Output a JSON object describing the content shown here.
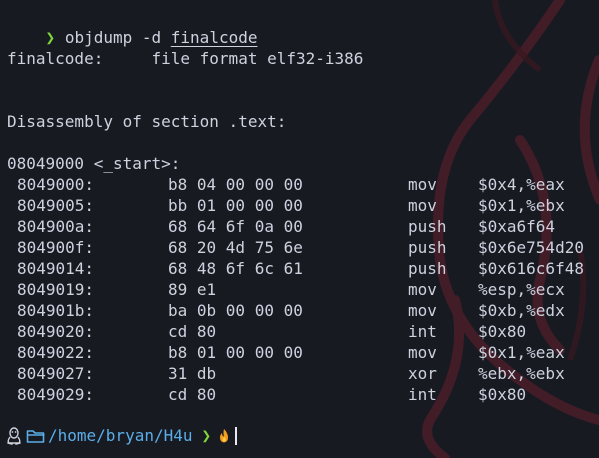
{
  "colors": {
    "background": "#181a22",
    "text": "#cdd2de",
    "prompt_arrow": "#7fd63b",
    "path": "#5aaee8",
    "flame": "#f39c1e",
    "decor": "#4a1d27"
  },
  "top_prompt": {
    "arrow": "❯",
    "command": "objdump -d",
    "argument": "finalcode"
  },
  "output": {
    "file_format_line": "finalcode:     file format elf32-i386",
    "section_line": "Disassembly of section .text:",
    "symbol_line": "08049000 <_start>:"
  },
  "disassembly": [
    {
      "addr": "8049000:",
      "bytes": "b8 04 00 00 00",
      "mnemonic": "mov",
      "operands": "$0x4,%eax"
    },
    {
      "addr": "8049005:",
      "bytes": "bb 01 00 00 00",
      "mnemonic": "mov",
      "operands": "$0x1,%ebx"
    },
    {
      "addr": "804900a:",
      "bytes": "68 64 6f 0a 00",
      "mnemonic": "push",
      "operands": "$0xa6f64"
    },
    {
      "addr": "804900f:",
      "bytes": "68 20 4d 75 6e",
      "mnemonic": "push",
      "operands": "$0x6e754d20"
    },
    {
      "addr": "8049014:",
      "bytes": "68 48 6f 6c 61",
      "mnemonic": "push",
      "operands": "$0x616c6f48"
    },
    {
      "addr": "8049019:",
      "bytes": "89 e1",
      "mnemonic": "mov",
      "operands": "%esp,%ecx"
    },
    {
      "addr": "804901b:",
      "bytes": "ba 0b 00 00 00",
      "mnemonic": "mov",
      "operands": "$0xb,%edx"
    },
    {
      "addr": "8049020:",
      "bytes": "cd 80",
      "mnemonic": "int",
      "operands": "$0x80"
    },
    {
      "addr": "8049022:",
      "bytes": "b8 01 00 00 00",
      "mnemonic": "mov",
      "operands": "$0x1,%eax"
    },
    {
      "addr": "8049027:",
      "bytes": "31 db",
      "mnemonic": "xor",
      "operands": "%ebx,%ebx"
    },
    {
      "addr": "8049029:",
      "bytes": "cd 80",
      "mnemonic": "int",
      "operands": "$0x80"
    }
  ],
  "bottom_prompt": {
    "os_icon": "linux-penguin-icon",
    "folder_icon": "folder-icon",
    "path": "/home/bryan/H4u",
    "arrow": "❯",
    "shell_icon": "flame-icon"
  }
}
